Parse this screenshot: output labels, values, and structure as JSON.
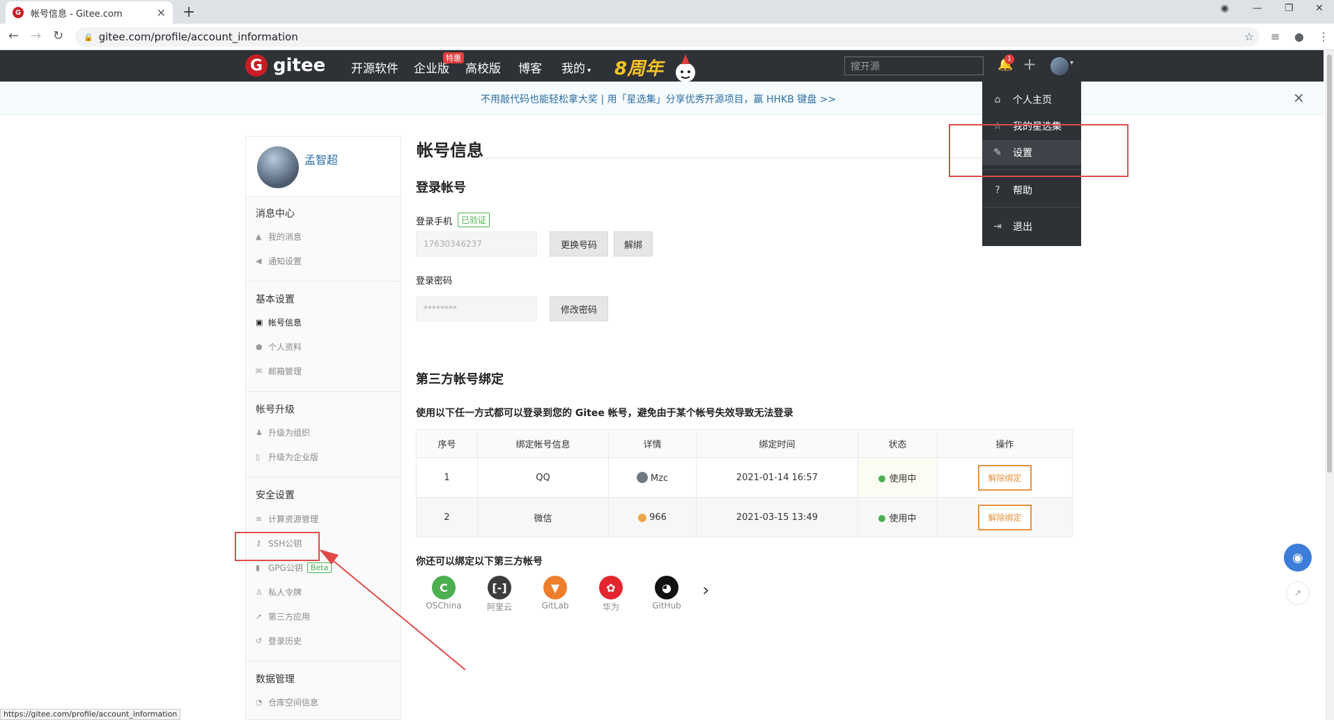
{
  "browser": {
    "tab_title": "帐号信息 - Gitee.com",
    "url": "gitee.com/profile/account_information",
    "status_url": "https://gitee.com/profile/account_information"
  },
  "header": {
    "logo_text": "gitee",
    "nav": [
      "开源软件",
      "企业版",
      "高校版",
      "博客",
      "我的"
    ],
    "enterprise_badge": "特惠",
    "anniversary": "8周年",
    "search_placeholder": "搜开源",
    "notification_count": "1"
  },
  "banner": {
    "text": "不用敲代码也能轻松拿大奖 | 用「星选集」分享优秀开源项目，赢 HHKB 键盘 >>",
    "close": "×"
  },
  "dropdown": {
    "items": [
      "个人主页",
      "我的星选集",
      "设置",
      "帮助",
      "退出"
    ]
  },
  "sidebar": {
    "user_name": "孟智超",
    "sections": [
      {
        "title": "消息中心",
        "items": [
          "我的消息",
          "通知设置"
        ]
      },
      {
        "title": "基本设置",
        "items": [
          "帐号信息",
          "个人资料",
          "邮箱管理"
        ]
      },
      {
        "title": "帐号升级",
        "items": [
          "升级为组织",
          "升级为企业版"
        ]
      },
      {
        "title": "安全设置",
        "items": [
          "计算资源管理",
          "SSH公钥",
          "GPG公钥",
          "私人令牌",
          "第三方应用",
          "登录历史"
        ]
      },
      {
        "title": "数据管理",
        "items": [
          "仓库空间信息"
        ]
      }
    ],
    "beta": "Beta"
  },
  "main": {
    "title": "帐号信息",
    "login_section": "登录帐号",
    "phone_label": "登录手机",
    "verified": "已验证",
    "phone_value": "17630346237",
    "change_phone": "更换号码",
    "unbind_phone": "解绑",
    "password_label": "登录密码",
    "password_value": "********",
    "change_password": "修改密码",
    "third_party_title": "第三方帐号绑定",
    "third_party_desc": "使用以下任一方式都可以登录到您的 Gitee 帐号，避免由于某个帐号失效导致无法登录",
    "table_headers": [
      "序号",
      "绑定帐号信息",
      "详情",
      "绑定时间",
      "状态",
      "操作"
    ],
    "rows": [
      {
        "index": "1",
        "account": "QQ",
        "detail": "Mzc",
        "time": "2021-01-14 16:57",
        "status": "使用中",
        "action": "解除绑定"
      },
      {
        "index": "2",
        "account": "微信",
        "detail": "966",
        "time": "2021-03-15 13:49",
        "status": "使用中",
        "action": "解除绑定"
      }
    ],
    "more_title": "你还可以绑定以下第三方帐号",
    "providers": [
      {
        "name": "OSChina",
        "color": "#4caf50"
      },
      {
        "name": "阿里云",
        "color": "#3c3c3c"
      },
      {
        "name": "GitLab",
        "color": "#ee7d2c"
      },
      {
        "name": "华为",
        "color": "#e2252e"
      },
      {
        "name": "GitHub",
        "color": "#111111"
      }
    ]
  },
  "colors": {
    "header_bg": "#2e3237",
    "brand_red": "#c71d23",
    "link_blue": "#2d6fa4",
    "annotation_red": "#e24a4a",
    "unbind_orange": "#e8913b",
    "status_green": "#4caf50"
  }
}
